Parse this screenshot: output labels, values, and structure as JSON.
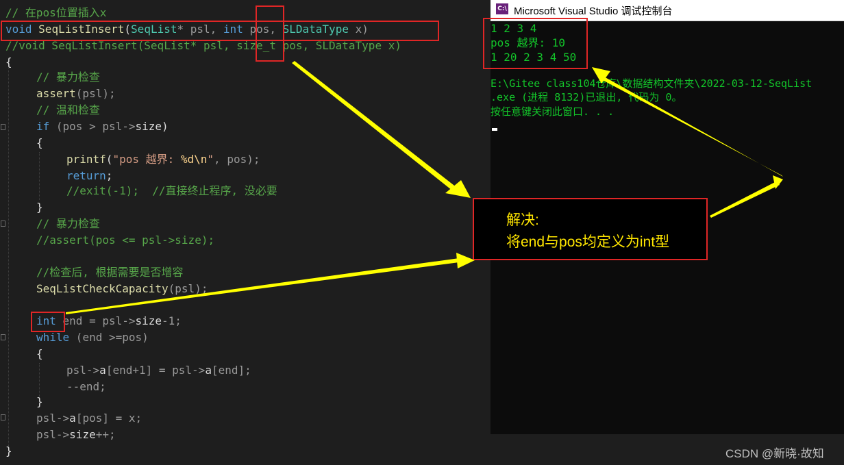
{
  "editor": {
    "lines": {
      "l1": "// 在pos位置插入x",
      "l2_void": "void",
      "l2_fn": "SeqListInsert",
      "l2_open": "(",
      "l2_type": "SeqList",
      "l2_p1": "* psl, ",
      "l2_int": "int",
      "l2_p2": " pos, ",
      "l2_type2": "SLDataType",
      "l2_p3": " x)",
      "l3": "//void SeqListInsert(SeqList* psl, size_t pos, SLDataType x)",
      "l4": "{",
      "l5": "// 暴力检查",
      "l6_fn": "assert",
      "l6_rest": "(psl);",
      "l7": "// 温和检查",
      "l8_kw": "if",
      "l8_a": " (pos > psl->",
      "l8_b": "size",
      "l8_c": ")",
      "l9": "{",
      "l10_fn": "printf",
      "l10_a": "(",
      "l10_s1": "\"pos 越界: ",
      "l10_es": "%d\\n",
      "l10_s2": "\"",
      "l10_b": ", pos);",
      "l11_kw": "return",
      "l11_b": ";",
      "l12": "//exit(-1);  //直接终止程序, 没必要",
      "l13": "}",
      "l14": "// 暴力检查",
      "l15": "//assert(pos <= psl->size);",
      "l17": "//检查后, 根据需要是否增容",
      "l18_fn": "SeqListCheckCapacity",
      "l18_rest": "(psl);",
      "l20_kw": "int",
      "l20_a": " end = psl->",
      "l20_b": "size",
      "l20_c": "-1;",
      "l21_kw": "while",
      "l21_rest": " (end >=pos)",
      "l22": "{",
      "l23_a": "psl->",
      "l23_b": "a",
      "l23_c": "[end+1] = psl->",
      "l23_d": "a",
      "l23_e": "[end];",
      "l24": "--end;",
      "l25": "}",
      "l26_a": "psl->",
      "l26_b": "a",
      "l26_c": "[pos] = x;",
      "l27_a": "psl->",
      "l27_b": "size",
      "l27_c": "++;",
      "l28": "}"
    }
  },
  "console": {
    "title": "Microsoft Visual Studio 调试控制台",
    "icon": "C:\\",
    "output": [
      "1 2 3 4",
      "pos 越界: 10",
      "1 20 2 3 4 50",
      "",
      "E:\\Gitee class104仓库\\数据结构文件夹\\2022-03-12-SeqList",
      ".exe (进程 8132)已退出, 代码为 0。",
      "按任意键关闭此窗口. . ."
    ]
  },
  "annotation": {
    "line1": "解决:",
    "line2": "将end与pos均定义为int型"
  },
  "watermark": "CSDN @新晓·故知",
  "colors": {
    "highlight_box": "#e02626",
    "arrow": "#ffff00",
    "console_text": "#13c52a"
  }
}
